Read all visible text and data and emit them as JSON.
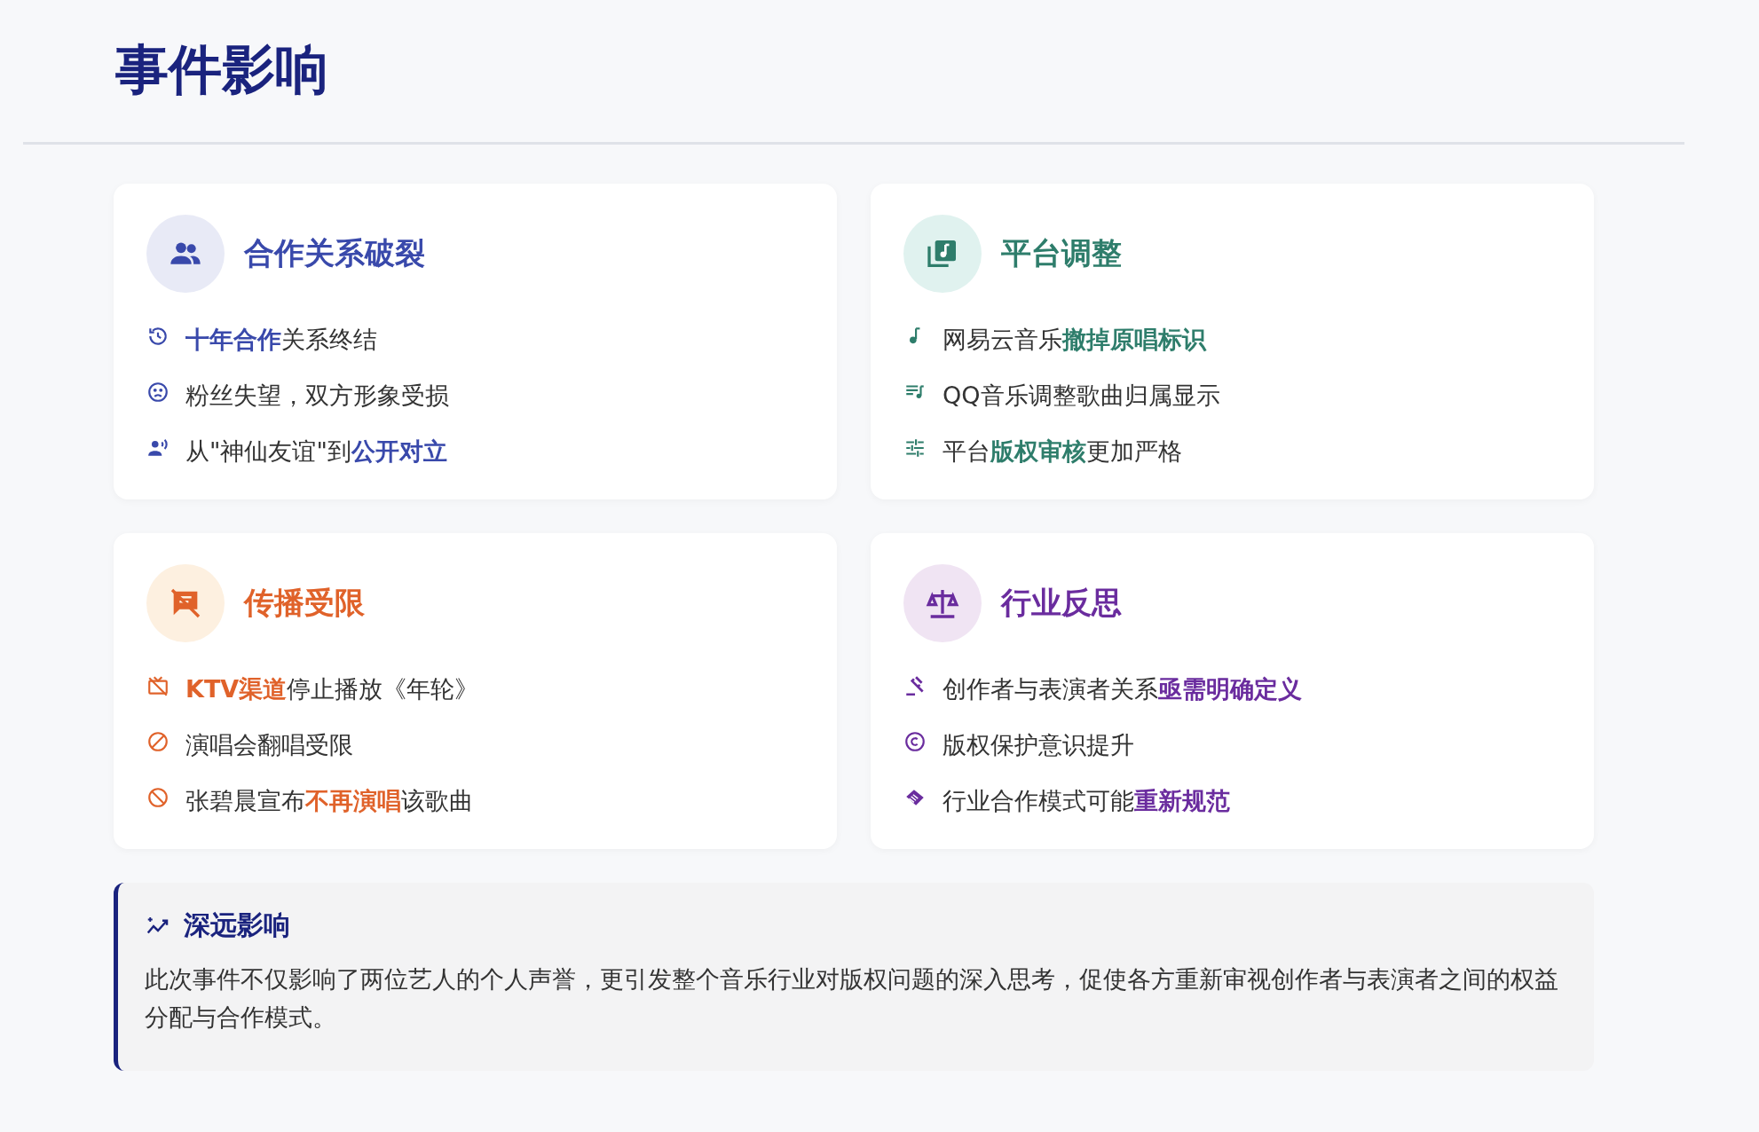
{
  "title": "事件影响",
  "cards": [
    {
      "title": "合作关系破裂",
      "color": "#3949ab",
      "items": [
        "**十年合作**关系终结",
        "粉丝失望，双方形象受损",
        "从\"神仙友谊\"到**公开对立**"
      ]
    },
    {
      "title": "平台调整",
      "color": "#2e7d6b",
      "items": [
        "网易云音乐**撤掉原唱标识**",
        "QQ音乐调整歌曲归属显示",
        "平台**版权审核**更加严格"
      ]
    },
    {
      "title": "传播受限",
      "color": "#e0622a",
      "items": [
        "**KTV渠道**停止播放《年轮》",
        "演唱会翻唱受限",
        "张碧晨宣布**不再演唱**该歌曲"
      ]
    },
    {
      "title": "行业反思",
      "color": "#6a2c9e",
      "items": [
        "创作者与表演者关系**亟需明确定义**",
        "版权保护意识提升",
        "行业合作模式可能**重新规范**"
      ]
    }
  ],
  "summary": {
    "title": "深远影响",
    "text": "此次事件不仅影响了两位艺人的个人声誉，更引发整个音乐行业对版权问题的深入思考，促使各方重新审视创作者与表演者之间的权益分配与合作模式。"
  }
}
